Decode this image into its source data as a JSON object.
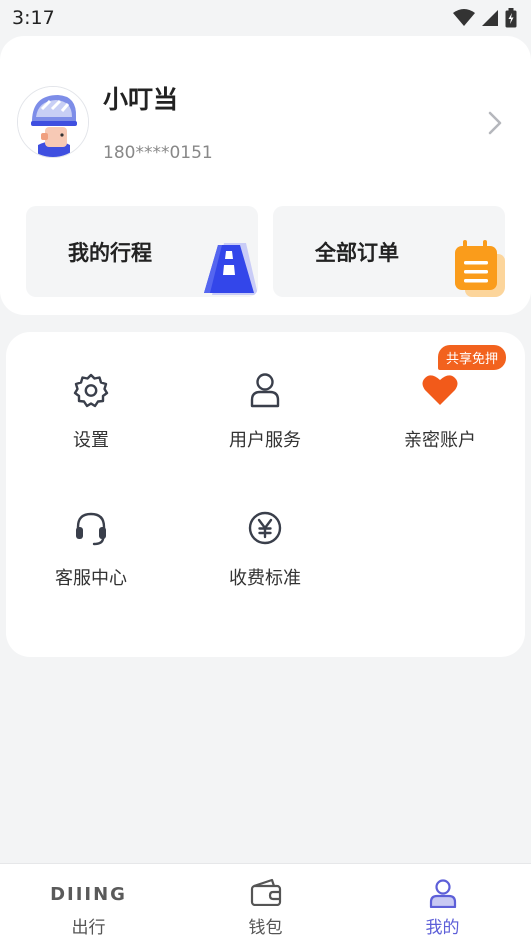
{
  "status_bar": {
    "time": "3:17"
  },
  "profile": {
    "name": "小叮当",
    "phone": "180****0151"
  },
  "quick_actions": [
    {
      "label": "我的行程",
      "icon": "road-icon"
    },
    {
      "label": "全部订单",
      "icon": "order-clipboard-icon"
    }
  ],
  "menu": {
    "items": [
      {
        "label": "设置",
        "icon": "gear-icon"
      },
      {
        "label": "用户服务",
        "icon": "user-icon"
      },
      {
        "label": "亲密账户",
        "icon": "heart-icon",
        "badge": "共享免押"
      },
      {
        "label": "客服中心",
        "icon": "headset-icon"
      },
      {
        "label": "收费标准",
        "icon": "yen-icon"
      }
    ]
  },
  "tab_bar": {
    "tabs": [
      {
        "label": "出行",
        "brand": "DIIING",
        "active": false
      },
      {
        "label": "钱包",
        "icon": "wallet-icon",
        "active": false
      },
      {
        "label": "我的",
        "icon": "profile-icon",
        "active": true
      }
    ]
  },
  "colors": {
    "accent": "#5d5fd8",
    "badge": "#f2621e",
    "heart": "#f25a1a",
    "icon": "#3a3f4b",
    "background": "#f3f4f5"
  }
}
